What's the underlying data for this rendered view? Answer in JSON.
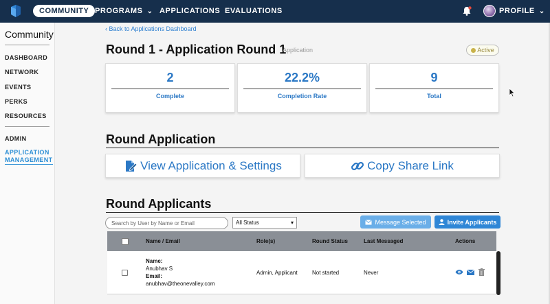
{
  "nav": {
    "community": "COMMUNITY",
    "programs": "PROGRAMS",
    "applications": "APPLICATIONS",
    "evaluations": "EVALUATIONS",
    "profile": "PROFILE"
  },
  "sidebar": {
    "title": "Community",
    "items": [
      "DASHBOARD",
      "NETWORK",
      "EVENTS",
      "PERKS",
      "RESOURCES"
    ],
    "admin": "ADMIN",
    "active_line1": "APPLICATION",
    "active_line2": "MANAGEMENT"
  },
  "main": {
    "back_link": "‹ Back to Applications Dashboard",
    "round_title": "Round 1 - Application Round 1",
    "round_subtitle": "Application",
    "status_badge": "Active",
    "stats": [
      {
        "value": "2",
        "label": "Complete"
      },
      {
        "value": "22.2%",
        "label": "Completion Rate"
      },
      {
        "value": "9",
        "label": "Total"
      }
    ],
    "section_application": "Round Application",
    "btn_view": "View Application & Settings",
    "btn_copy": "Copy Share Link",
    "section_applicants": "Round Applicants",
    "search_placeholder": "Search by User by Name or Email",
    "status_filter": "All Status",
    "btn_message": "Message Selected",
    "btn_invite": "Invite Applicants"
  },
  "table": {
    "headers": {
      "name_email": "Name / Email",
      "roles": "Role(s)",
      "round_status": "Round Status",
      "last_messaged": "Last Messaged",
      "actions": "Actions"
    },
    "rows": [
      {
        "name_label": "Name:",
        "name": "Anubhav S",
        "email_label": "Email:",
        "email": "anubhav@theonevalley.com",
        "roles": "Admin, Applicant",
        "round_status": "Not started",
        "last_messaged": "Never"
      }
    ]
  },
  "colors": {
    "navbar": "#162f4c",
    "accent": "#2b78c5",
    "link": "#2d8fd5",
    "table_header": "#8a8f96"
  }
}
